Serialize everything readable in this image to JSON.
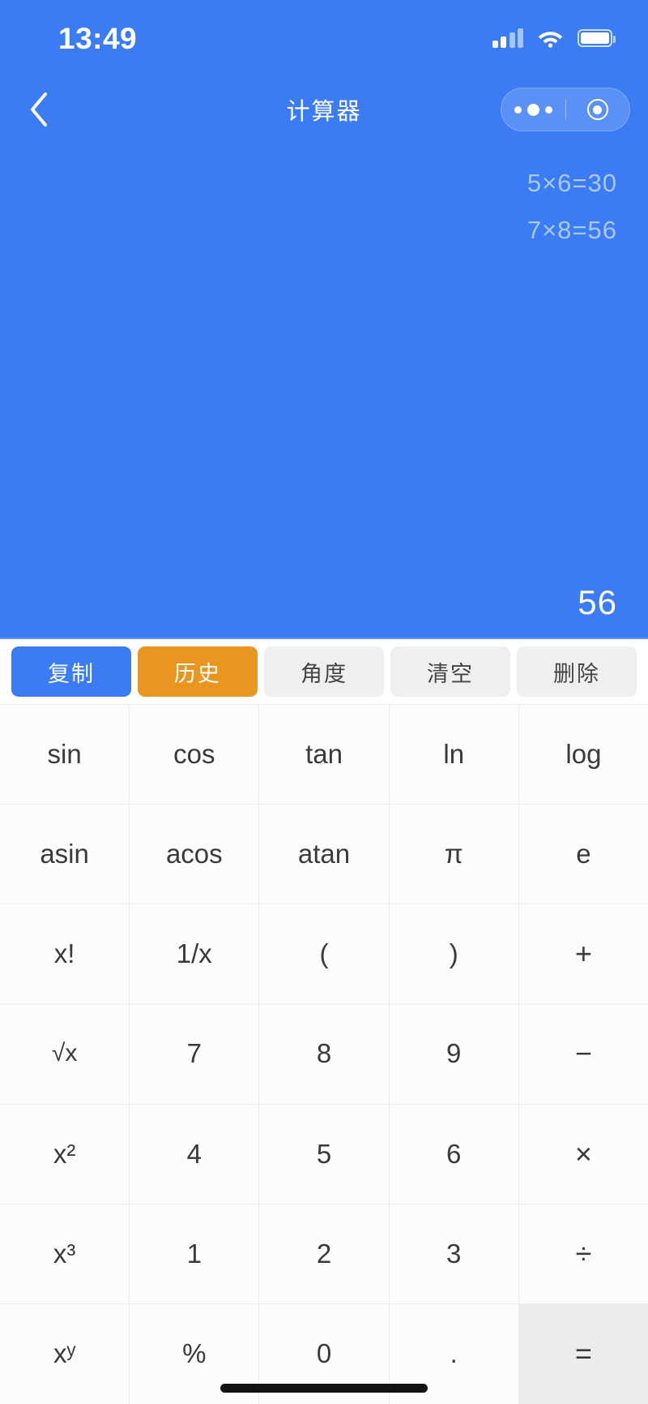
{
  "status_bar": {
    "time": "13:49",
    "signal_icon": "cellular-signal-icon",
    "wifi_icon": "wifi-icon",
    "battery_icon": "battery-icon"
  },
  "nav_bar": {
    "back_icon": "chevron-left-icon",
    "title": "计算器",
    "capsule": {
      "more_icon": "more-dots-icon",
      "target_icon": "target-circle-icon"
    }
  },
  "display": {
    "history": [
      "5×6=30",
      "7×8=56"
    ],
    "result": "56"
  },
  "actions": [
    {
      "label": "复制",
      "name": "copy-button",
      "style": "primary"
    },
    {
      "label": "历史",
      "name": "history-button",
      "style": "warn"
    },
    {
      "label": "角度",
      "name": "degree-button",
      "style": "plain"
    },
    {
      "label": "清空",
      "name": "clear-button",
      "style": "plain"
    },
    {
      "label": "删除",
      "name": "delete-button",
      "style": "plain"
    }
  ],
  "keypad": {
    "rows": [
      [
        {
          "label": "sin",
          "name": "key-sin"
        },
        {
          "label": "cos",
          "name": "key-cos"
        },
        {
          "label": "tan",
          "name": "key-tan"
        },
        {
          "label": "ln",
          "name": "key-ln"
        },
        {
          "label": "log",
          "name": "key-log"
        }
      ],
      [
        {
          "label": "asin",
          "name": "key-asin"
        },
        {
          "label": "acos",
          "name": "key-acos"
        },
        {
          "label": "atan",
          "name": "key-atan"
        },
        {
          "label": "π",
          "name": "key-pi"
        },
        {
          "label": "e",
          "name": "key-e"
        }
      ],
      [
        {
          "label": "x!",
          "name": "key-factorial"
        },
        {
          "label": "1/x",
          "name": "key-reciprocal"
        },
        {
          "label": "(",
          "name": "key-paren-open"
        },
        {
          "label": ")",
          "name": "key-paren-close"
        },
        {
          "label": "+",
          "name": "key-plus"
        }
      ],
      [
        {
          "label": "√x",
          "name": "key-sqrt"
        },
        {
          "label": "7",
          "name": "key-7"
        },
        {
          "label": "8",
          "name": "key-8"
        },
        {
          "label": "9",
          "name": "key-9"
        },
        {
          "label": "−",
          "name": "key-minus"
        }
      ],
      [
        {
          "label": "x²",
          "name": "key-square"
        },
        {
          "label": "4",
          "name": "key-4"
        },
        {
          "label": "5",
          "name": "key-5"
        },
        {
          "label": "6",
          "name": "key-6"
        },
        {
          "label": "×",
          "name": "key-multiply"
        }
      ],
      [
        {
          "label": "x³",
          "name": "key-cube"
        },
        {
          "label": "1",
          "name": "key-1"
        },
        {
          "label": "2",
          "name": "key-2"
        },
        {
          "label": "3",
          "name": "key-3"
        },
        {
          "label": "÷",
          "name": "key-divide"
        }
      ],
      [
        {
          "label": "xʸ",
          "name": "key-power"
        },
        {
          "label": "%",
          "name": "key-percent"
        },
        {
          "label": "0",
          "name": "key-0"
        },
        {
          "label": ".",
          "name": "key-decimal"
        },
        {
          "label": "=",
          "name": "key-equals"
        }
      ]
    ]
  },
  "colors": {
    "brand_blue": "#3b7cf5",
    "accent_orange": "#e8961f",
    "key_bg": "#fcfcfc",
    "equals_bg": "#ececec",
    "history_text": "#a9c8fb"
  }
}
